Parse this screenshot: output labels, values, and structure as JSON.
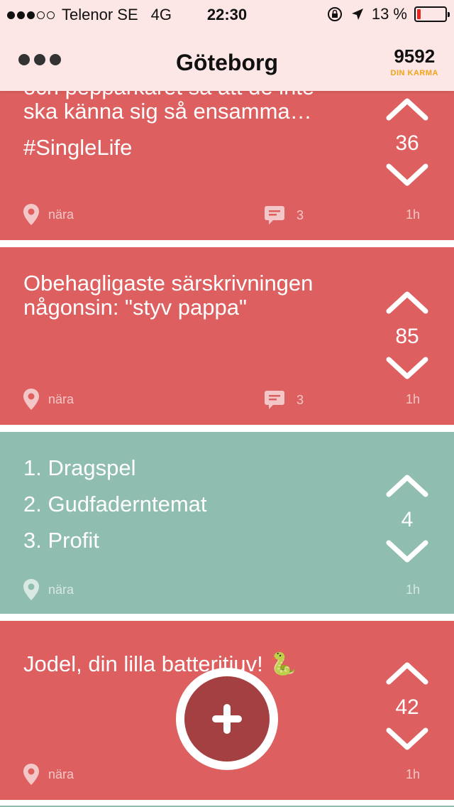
{
  "status_bar": {
    "carrier": "Telenor SE",
    "network": "4G",
    "time": "22:30",
    "battery_text": "13 %",
    "battery_level": 0.13,
    "signal_bars": 3,
    "signal_max": 5
  },
  "nav": {
    "title": "Göteborg",
    "karma_value": "9592",
    "karma_label": "DIN KARMA"
  },
  "posts": [
    {
      "color": "#dd5f5f",
      "lines": [
        "och pepparkaret så att de inte",
        "ska känna sig så ensamma…"
      ],
      "extra": "#SingleLife",
      "votes": "36",
      "location": "nära",
      "comments": "3",
      "time": "1h"
    },
    {
      "color": "#dd5f5f",
      "lines": [
        "Obehagligaste särskrivningen",
        "någonsin: \"styv pappa\""
      ],
      "votes": "85",
      "location": "nära",
      "comments": "3",
      "time": "1h"
    },
    {
      "color": "#8fbdb0",
      "items": [
        "1. Dragspel",
        "2. Gudfaderntemat",
        "3. Profit"
      ],
      "votes": "4",
      "location": "nära",
      "time": "1h"
    },
    {
      "color": "#dd5f5f",
      "lines": [
        "Jodel, din lilla batteritjuv! 🐍"
      ],
      "votes": "42",
      "location": "nära",
      "time": "1h"
    }
  ],
  "fab": {
    "icon": "plus-icon"
  },
  "icons": {
    "menu": "more-dots-icon",
    "location": "location-pin-icon",
    "comments": "comment-bubble-icon",
    "upvote": "chevron-up-icon",
    "downvote": "chevron-down-icon"
  }
}
